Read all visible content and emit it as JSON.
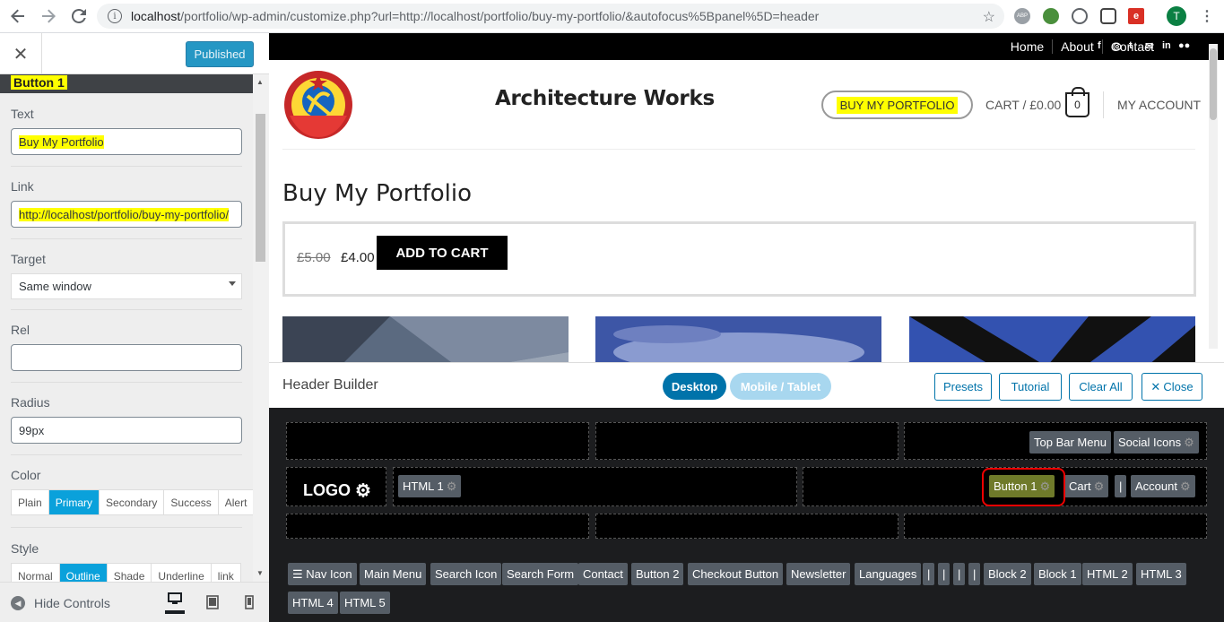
{
  "browser": {
    "url_host": "localhost",
    "url_rest": "/portfolio/wp-admin/customize.php?url=http://localhost/portfolio/buy-my-portfolio/&autofocus%5Bpanel%5D=header",
    "avatar": "T",
    "icons": {
      "back": "arrow-left-icon",
      "forward": "arrow-right-icon",
      "reload": "reload-icon",
      "info": "info-icon",
      "star": "star-icon",
      "menu": "kebab-menu-icon"
    }
  },
  "panel": {
    "close": "✕",
    "publish": "Published",
    "section": "Button 1",
    "fields": {
      "text_label": "Text",
      "text_value": "Buy My Portfolio",
      "link_label": "Link",
      "link_value": "http://localhost/portfolio/buy-my-portfolio/",
      "target_label": "Target",
      "target_value": "Same window",
      "rel_label": "Rel",
      "rel_value": "",
      "radius_label": "Radius",
      "radius_value": "99px",
      "color_label": "Color",
      "colors": [
        "Plain",
        "Primary",
        "Secondary",
        "Success",
        "Alert"
      ],
      "color_selected": "Primary",
      "style_label": "Style",
      "styles": [
        "Normal",
        "Outline",
        "Shade",
        "Underline",
        "link"
      ],
      "style_selected": "Outline"
    },
    "footer": {
      "hide": "Hide Controls",
      "devices": [
        "desktop",
        "tablet",
        "mobile"
      ],
      "device_selected": "desktop"
    }
  },
  "preview": {
    "topnav": [
      "Home",
      "About",
      "Contact"
    ],
    "social": [
      "facebook-icon",
      "instagram-icon",
      "twitter-icon",
      "email-icon",
      "linkedin-icon",
      "flickr-icon"
    ],
    "site_title": "Architecture Works",
    "buy_button": "BUY MY PORTFOLIO",
    "cart": "CART / £0.00",
    "cart_count": "0",
    "account": "MY ACCOUNT",
    "product_title": "Buy My Portfolio",
    "old_price": "£5.00",
    "new_price": "£4.00",
    "add_to_cart": "ADD TO CART"
  },
  "builder": {
    "title": "Header Builder",
    "desktop": "Desktop",
    "mobile": "Mobile / Tablet",
    "buttons": [
      "Presets",
      "Tutorial",
      "Clear All",
      "Close"
    ],
    "top_right": [
      "Top Bar Menu",
      "Social Icons"
    ],
    "logo": "LOGO",
    "html1": "HTML 1",
    "right": [
      "Button 1",
      "Cart",
      "|",
      "Account"
    ],
    "available": [
      "☰ Nav Icon",
      "Main Menu",
      "Search Icon",
      "Search Form",
      "Contact",
      "Button 2",
      "Checkout Button",
      "Newsletter",
      "Languages",
      "|",
      "|",
      "|",
      "|",
      "Block 2",
      "Block 1",
      "HTML 2",
      "HTML 3",
      "HTML 4",
      "HTML 5"
    ]
  },
  "colors": {
    "accent": "#0085ba",
    "primary": "#0aa1db",
    "highlight": "#ffff00",
    "annotation": "#ee0000",
    "builder_bg": "#1c1d1f",
    "chip": "#555d66"
  }
}
